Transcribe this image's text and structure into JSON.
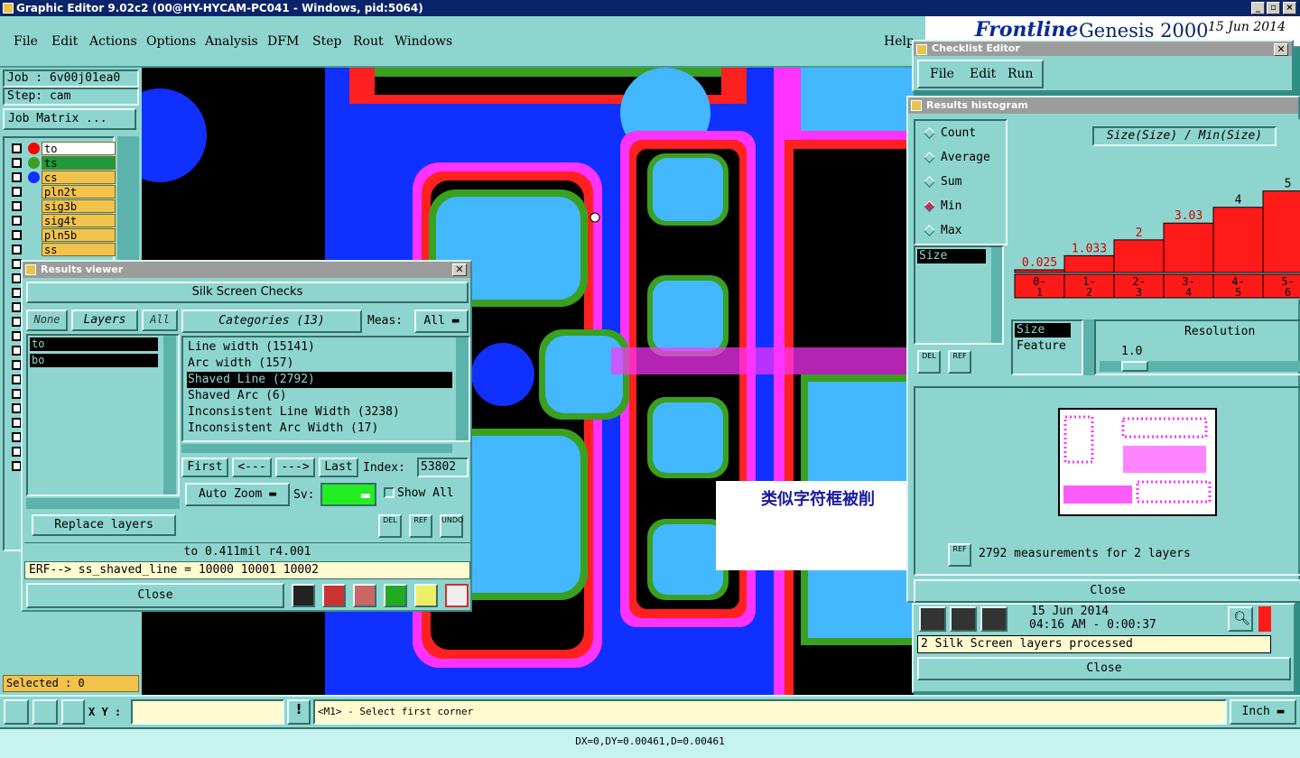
{
  "window": {
    "title": "Graphic Editor 9.02c2 (00@HY-HYCAM-PC041 - Windows, pid:5064)"
  },
  "menu": {
    "items": [
      "File",
      "Edit",
      "Actions",
      "Options",
      "Analysis",
      "DFM",
      "Step",
      "Rout",
      "Windows"
    ],
    "help": "Help"
  },
  "brand": {
    "logo": "Frontline",
    "product": "Genesis 2000",
    "date_partial": "15 Jun 2014"
  },
  "job": {
    "job_label": "Job : 6v00j01ea0",
    "step_label": "Step: cam",
    "matrix_button": "Job Matrix ..."
  },
  "layers": [
    {
      "name": "to",
      "dot": "#ff0000",
      "bg": "#ffffff"
    },
    {
      "name": "ts",
      "dot": "#3aa020",
      "bg": "#1f9a3a"
    },
    {
      "name": "cs",
      "dot": "#1030ff",
      "bg": "#f2c34a"
    },
    {
      "name": "pln2t",
      "dot": "",
      "bg": "#f2c34a"
    },
    {
      "name": "sig3b",
      "dot": "",
      "bg": "#f2c34a"
    },
    {
      "name": "sig4t",
      "dot": "",
      "bg": "#f2c34a"
    },
    {
      "name": "pln5b",
      "dot": "",
      "bg": "#f2c34a"
    },
    {
      "name": "ss",
      "dot": "",
      "bg": "#f2c34a"
    }
  ],
  "selected": "Selected : 0",
  "results_viewer": {
    "title": "Results viewer",
    "header": "Silk Screen Checks",
    "none_btn": "None",
    "layers_btn": "Layers",
    "all_btn": "All",
    "layer_list": [
      "to",
      "bo"
    ],
    "categories_btn": "Categories (13)",
    "meas_label": "Meas:",
    "meas_value": "All",
    "categories": [
      "Line width (15141)",
      "Arc width (157)",
      "Shaved Line (2792)",
      "Shaved Arc (6)",
      "Inconsistent Line Width (3238)",
      "Inconsistent Arc Width (17)"
    ],
    "selected_category": 2,
    "nav": {
      "first": "First",
      "prev": "<---",
      "next": "--->",
      "last": "Last",
      "index_label": "Index:",
      "index_value": "53802"
    },
    "auto_zoom": "Auto Zoom",
    "sv_label": "Sv:",
    "show_all": "Show All",
    "replace_layers": "Replace layers",
    "del": "DEL",
    "ref": "REF",
    "undo": "UNDO",
    "status": "to 0.411mil  r4.001",
    "erf": "ERF--> ss_shaved_line = 10000 10001 10002",
    "close": "Close"
  },
  "checklist": {
    "title": "Checklist Editor",
    "menu": [
      "File",
      "Edit",
      "Run"
    ]
  },
  "histogram": {
    "title": "Results histogram",
    "modes": [
      "Count",
      "Average",
      "Sum",
      "Min",
      "Max"
    ],
    "selected_mode": "Min",
    "chart_title": "Size(Size) / Min(Size)",
    "list_top": "Size",
    "list_bottom": [
      "Size",
      "Feature"
    ],
    "resolution_label": "Resolution",
    "resolution_value": "1.0",
    "del": "DEL",
    "ref": "REF",
    "summary": "2792 measurements for 2 layers",
    "close": "Close"
  },
  "chart_data": {
    "type": "bar",
    "title": "Size(Size) / Min(Size)",
    "categories": [
      "0-\n1",
      "1-\n2",
      "2-\n3",
      "3-\n4",
      "4-\n5",
      "5-\n6"
    ],
    "values": [
      0.025,
      1.033,
      2,
      3.03,
      4,
      5
    ],
    "value_labels": [
      "0.025",
      "1.033",
      "2",
      "3.03",
      "4",
      "5"
    ],
    "ylim": [
      0,
      5.6
    ]
  },
  "checklist_status": {
    "date": "15 Jun 2014",
    "time": "04:16 AM - 0:00:37",
    "message": "2 Silk Screen layers processed",
    "close": "Close"
  },
  "annotation": {
    "text": "类似字符框被削"
  },
  "bottom": {
    "xy_label": "X Y :",
    "xy_value": "",
    "prompt": "<M1> - Select first corner",
    "units": "Inch",
    "coords": "DX=0,DY=0.00461,D=0.00461"
  },
  "colors": {
    "teal": "#8fd5cf",
    "bar": "#ff1a1a",
    "magenta": "#ff33ff",
    "blue": "#1030ff",
    "lightblue": "#44b8ff",
    "green": "#3aa020"
  }
}
